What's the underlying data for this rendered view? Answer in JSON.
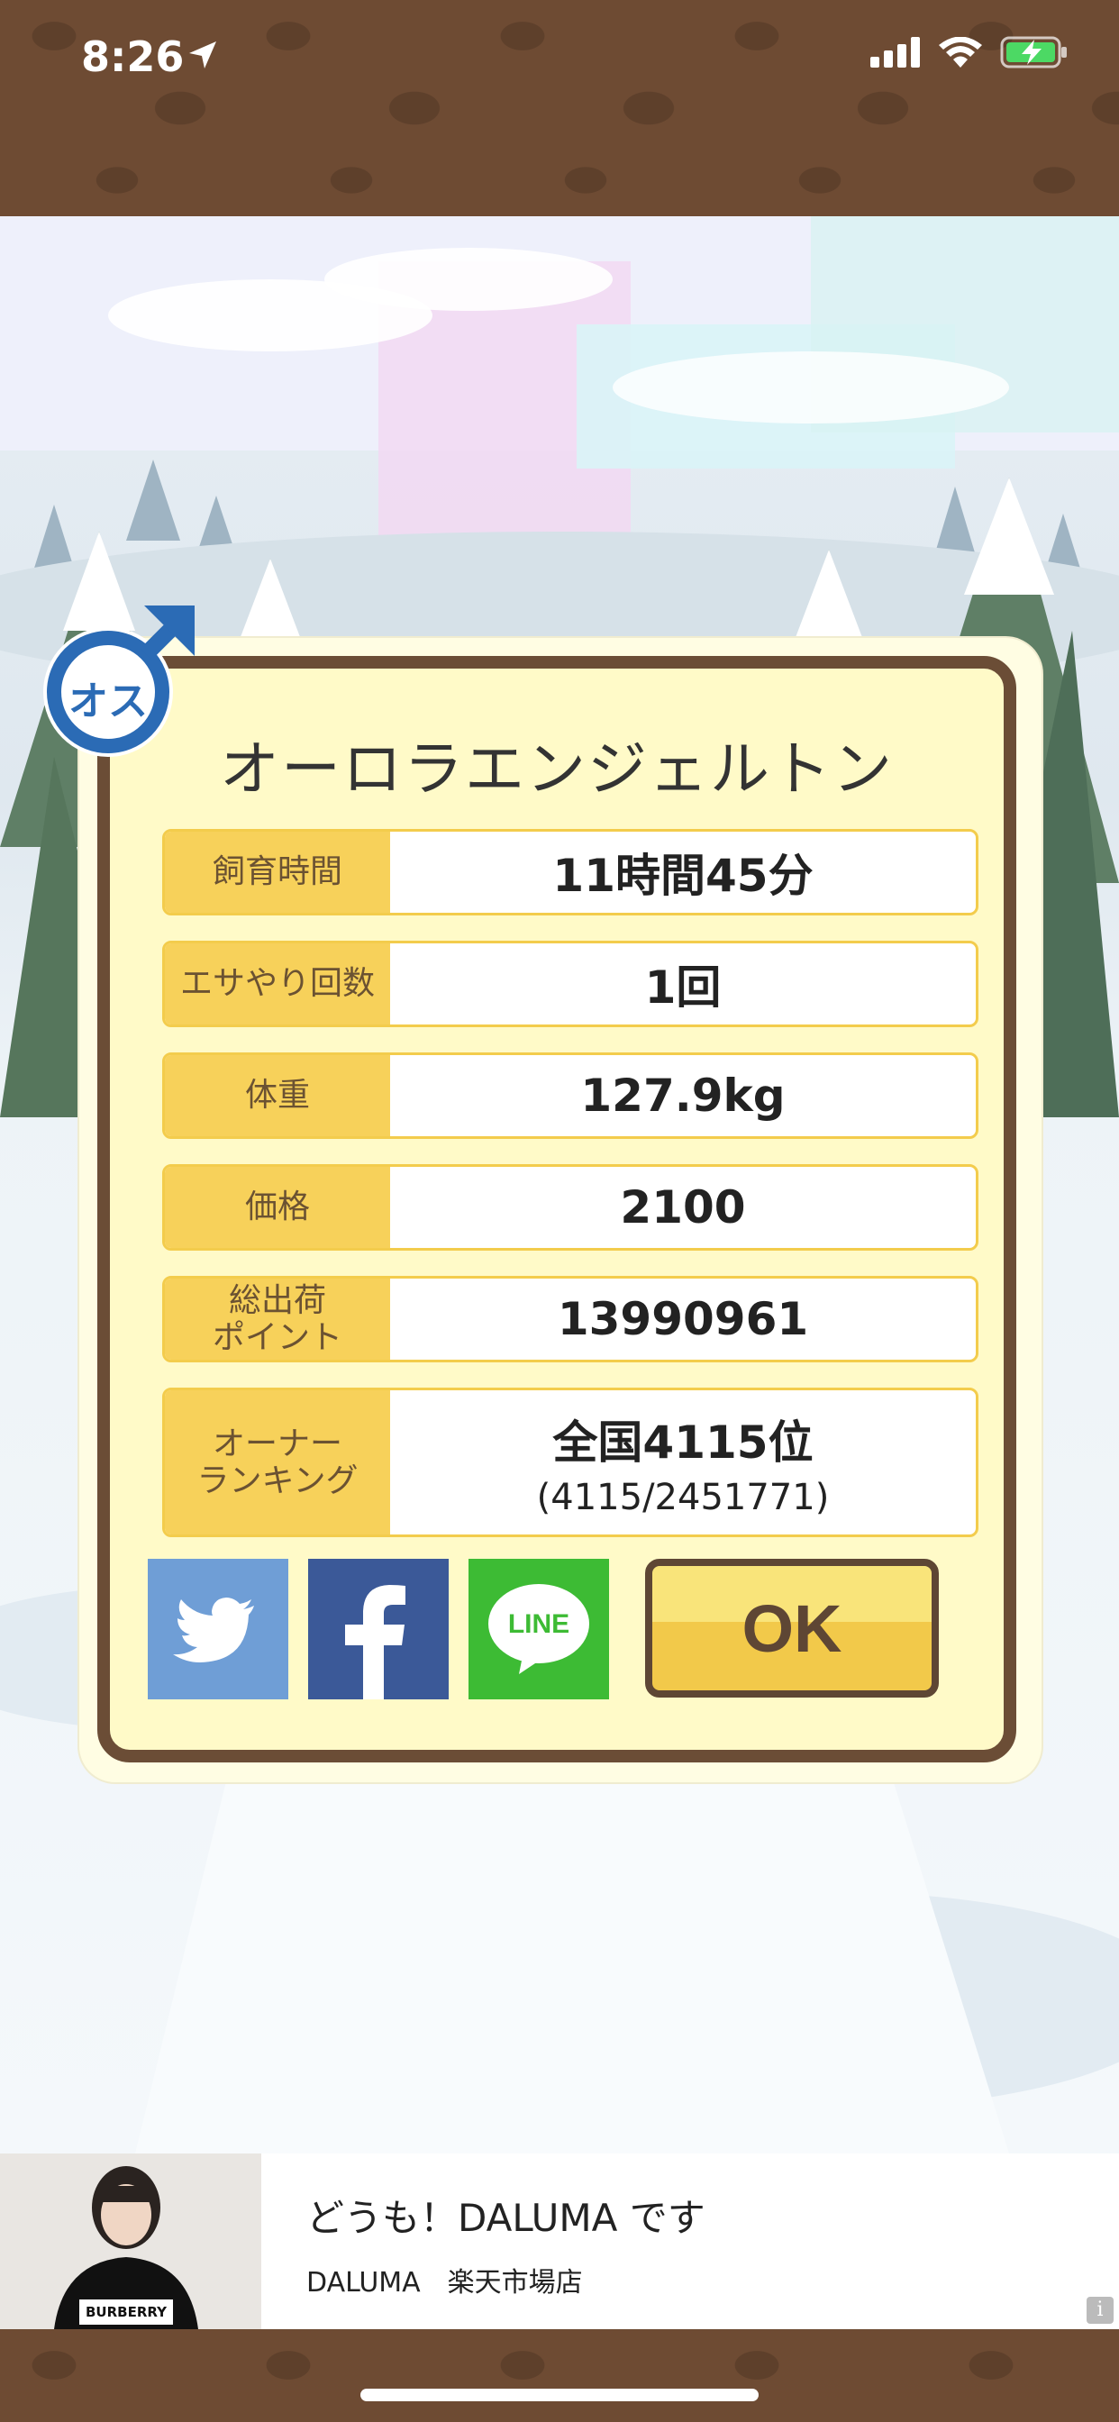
{
  "status_bar": {
    "time": "8:26"
  },
  "dialog": {
    "title": "オーロラエンジェルトン",
    "gender_badge": "オス",
    "rows": [
      {
        "label": "飼育時間",
        "value": "11時間45分"
      },
      {
        "label": "エサやり回数",
        "value": "1回"
      },
      {
        "label": "体重",
        "value": "127.9kg"
      },
      {
        "label": "価格",
        "value": "2100"
      },
      {
        "label": "総出荷\nポイント",
        "value": "13990961"
      },
      {
        "label": "オーナー\nランキング",
        "value": "全国4115位",
        "sub": "(4115/2451771)"
      }
    ],
    "share": {
      "line_label": "LINE"
    },
    "ok_label": "OK"
  },
  "ad": {
    "title": "どうも！DALUMA です",
    "subtitle": "DALUMA　楽天市場店",
    "photo_text": "BURBERRY",
    "info": "i"
  },
  "colors": {
    "brown": "#6b4d36",
    "dialog_bg": "#fffac8",
    "label_yellow": "#f7d15a",
    "twitter": "#6f9ed6",
    "facebook": "#3b5998",
    "line": "#3dbb34"
  }
}
